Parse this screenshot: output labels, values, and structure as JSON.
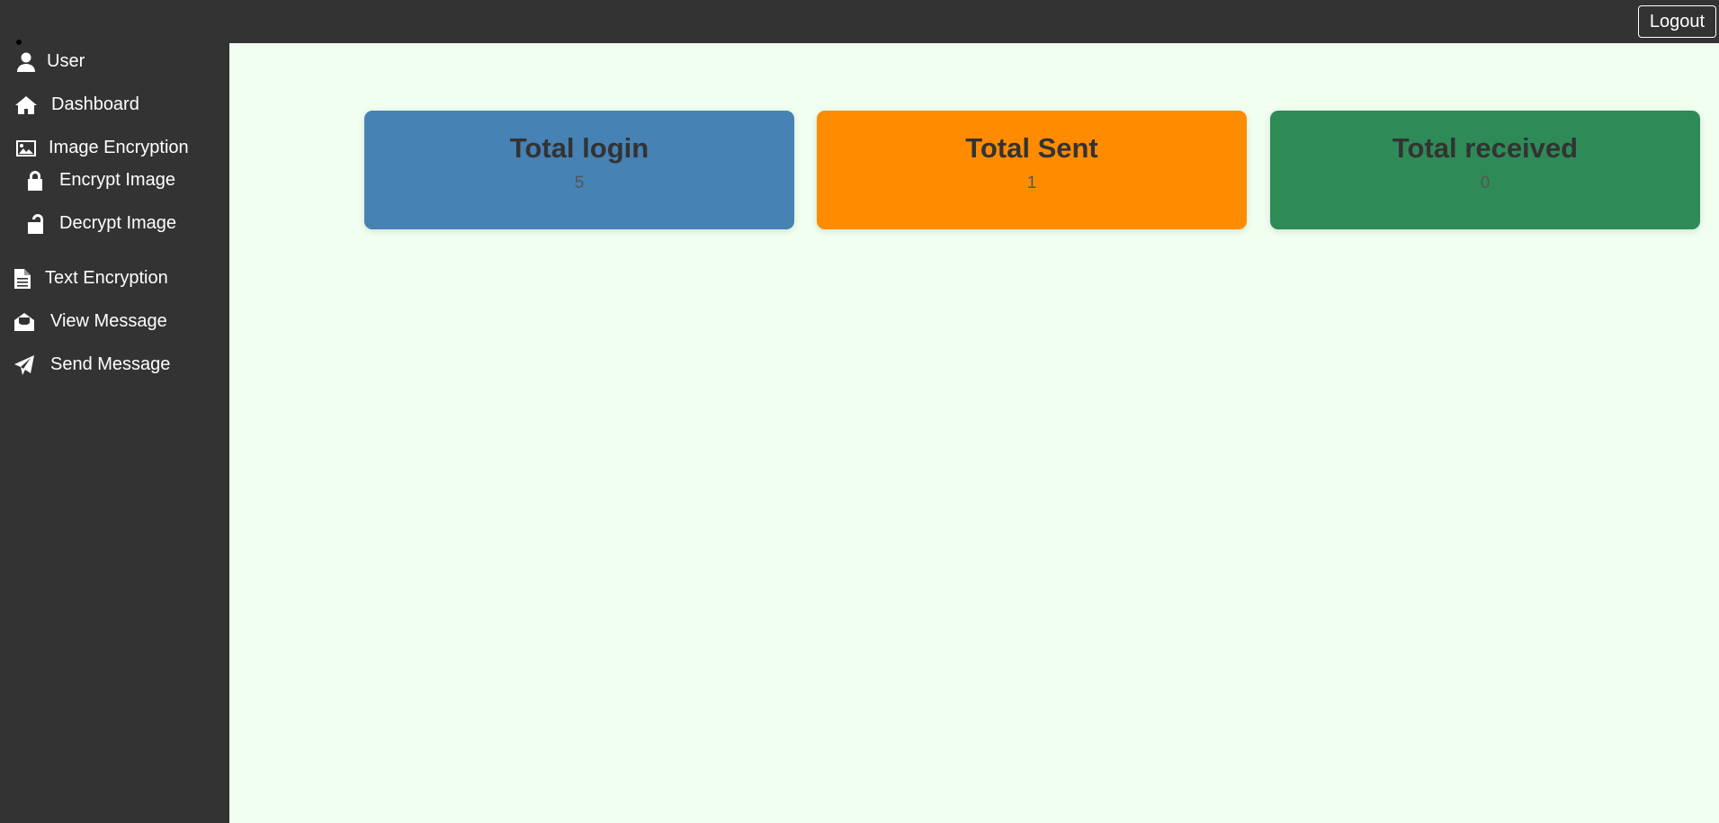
{
  "header": {
    "logout_label": "Logout"
  },
  "sidebar": {
    "items": [
      {
        "label": "User",
        "icon": "user-icon"
      },
      {
        "label": "Dashboard",
        "icon": "home-icon"
      },
      {
        "label": "Image Encryption",
        "icon": "image-icon"
      },
      {
        "label": "Encrypt Image",
        "icon": "lock-icon"
      },
      {
        "label": "Decrypt Image",
        "icon": "unlock-icon"
      },
      {
        "label": "Text Encryption",
        "icon": "file-text-icon"
      },
      {
        "label": "View Message",
        "icon": "envelope-open-icon"
      },
      {
        "label": "Send Message",
        "icon": "paper-plane-icon"
      }
    ]
  },
  "cards": [
    {
      "title": "Total login",
      "value": "5",
      "color": "#4682b4"
    },
    {
      "title": "Total Sent",
      "value": "1",
      "color": "#ff8c00"
    },
    {
      "title": "Total received",
      "value": "0",
      "color": "#2e8b57"
    }
  ],
  "colors": {
    "header_bg": "#333333",
    "sidebar_bg": "#333333",
    "main_bg": "#f0fff0",
    "card_text": "#333333"
  }
}
